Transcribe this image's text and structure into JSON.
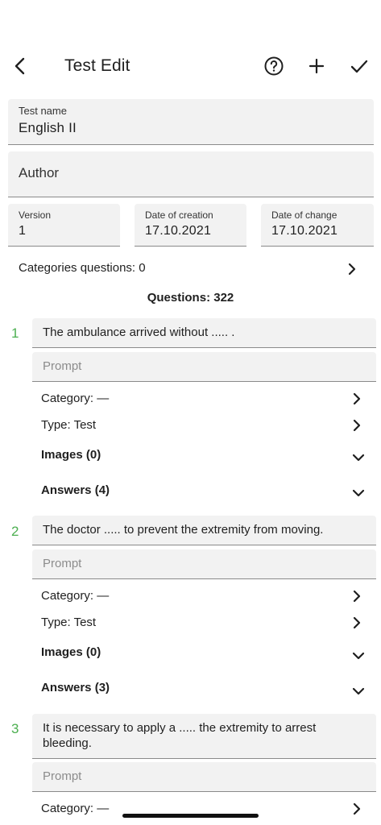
{
  "header": {
    "title": "Test Edit",
    "icons": [
      "back-arrow-icon",
      "help-circle-icon",
      "plus-icon",
      "check-icon"
    ]
  },
  "form": {
    "test_name_label": "Test name",
    "test_name_value": "English II",
    "author_label": "Author",
    "version_label": "Version",
    "version_value": "1",
    "creation_label": "Date of creation",
    "creation_value": "17.10.2021",
    "change_label": "Date of change",
    "change_value": "17.10.2021",
    "categories_questions": "Categories questions: 0"
  },
  "questions_header": "Questions: 322",
  "questions": [
    {
      "number": "1",
      "text": "The ambulance arrived without ..... .",
      "prompt_placeholder": "Prompt",
      "category": "Category: —",
      "type": "Type: Test",
      "images": "Images (0)",
      "answers": "Answers (4)"
    },
    {
      "number": "2",
      "text": "The doctor ..... to prevent the extremity from moving.",
      "prompt_placeholder": "Prompt",
      "category": "Category: —",
      "type": "Type: Test",
      "images": "Images (0)",
      "answers": "Answers (3)"
    },
    {
      "number": "3",
      "text": "It is necessary to apply a ..... the extremity to arrest bleeding.",
      "prompt_placeholder": "Prompt",
      "category": "Category: —"
    }
  ],
  "colors": {
    "accent_green": "#4caf50",
    "field_bg": "#f2f2f2",
    "underline": "#8a8a8a"
  }
}
